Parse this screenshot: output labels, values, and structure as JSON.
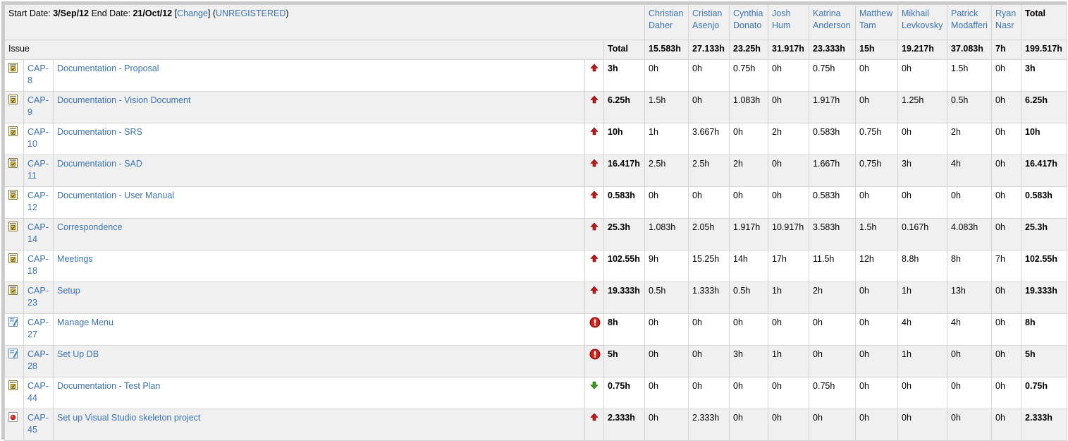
{
  "header": {
    "start_label": "Start Date:",
    "start_date": "3/Sep/12",
    "end_label": "End Date:",
    "end_date": "21/Oct/12",
    "change_link": "Change",
    "unregistered_link": "UNREGISTERED",
    "issue_col": "Issue",
    "total_col": "Total",
    "grand_total_label": "Total",
    "grand_total": "199.517h"
  },
  "people": [
    {
      "first": "Christian",
      "last": "Daher",
      "total": "15.583h"
    },
    {
      "first": "Cristian",
      "last": "Asenjo",
      "total": "27.133h"
    },
    {
      "first": "Cynthia",
      "last": "Donato",
      "total": "23.25h"
    },
    {
      "first": "Josh",
      "last": "Hum",
      "total": "31.917h"
    },
    {
      "first": "Katrina",
      "last": "Anderson",
      "total": "23.333h"
    },
    {
      "first": "Matthew",
      "last": "Tam",
      "total": "15h"
    },
    {
      "first": "Mikhail",
      "last": "Levkovsky",
      "total": "19.217h"
    },
    {
      "first": "Patrick",
      "last": "Modafferi",
      "total": "37.083h"
    },
    {
      "first": "Ryan",
      "last": "Nasr",
      "total": "7h"
    }
  ],
  "issues": [
    {
      "key_a": "CAP-",
      "key_b": "8",
      "summary": "Documentation - Proposal",
      "type": "task-icon",
      "priority": "major-priority-icon",
      "total": "3h",
      "hours": [
        "0h",
        "0h",
        "0.75h",
        "0h",
        "0.75h",
        "0h",
        "0h",
        "1.5h",
        "0h"
      ]
    },
    {
      "key_a": "CAP-",
      "key_b": "9",
      "summary": "Documentation - Vision Document",
      "type": "task-icon",
      "priority": "major-priority-icon",
      "total": "6.25h",
      "hours": [
        "1.5h",
        "0h",
        "1.083h",
        "0h",
        "1.917h",
        "0h",
        "1.25h",
        "0.5h",
        "0h"
      ]
    },
    {
      "key_a": "CAP-",
      "key_b": "10",
      "summary": "Documentation - SRS",
      "type": "task-icon",
      "priority": "major-priority-icon",
      "total": "10h",
      "hours": [
        "1h",
        "3.667h",
        "0h",
        "2h",
        "0.583h",
        "0.75h",
        "0h",
        "2h",
        "0h"
      ]
    },
    {
      "key_a": "CAP-",
      "key_b": "11",
      "summary": "Documentation - SAD",
      "type": "task-icon",
      "priority": "major-priority-icon",
      "total": "16.417h",
      "hours": [
        "2.5h",
        "2.5h",
        "2h",
        "0h",
        "1.667h",
        "0.75h",
        "3h",
        "4h",
        "0h"
      ]
    },
    {
      "key_a": "CAP-",
      "key_b": "12",
      "summary": "Documentation - User Manual",
      "type": "task-icon",
      "priority": "major-priority-icon",
      "total": "0.583h",
      "hours": [
        "0h",
        "0h",
        "0h",
        "0h",
        "0.583h",
        "0h",
        "0h",
        "0h",
        "0h"
      ]
    },
    {
      "key_a": "CAP-",
      "key_b": "14",
      "summary": "Correspondence",
      "type": "task-icon",
      "priority": "major-priority-icon",
      "total": "25.3h",
      "hours": [
        "1.083h",
        "2.05h",
        "1.917h",
        "10.917h",
        "3.583h",
        "1.5h",
        "0.167h",
        "4.083h",
        "0h"
      ]
    },
    {
      "key_a": "CAP-",
      "key_b": "18",
      "summary": "Meetings",
      "type": "task-icon",
      "priority": "major-priority-icon",
      "total": "102.55h",
      "hours": [
        "9h",
        "15.25h",
        "14h",
        "17h",
        "11.5h",
        "12h",
        "8.8h",
        "8h",
        "7h"
      ]
    },
    {
      "key_a": "CAP-",
      "key_b": "23",
      "summary": "Setup",
      "type": "task-icon",
      "priority": "major-priority-icon",
      "total": "19.333h",
      "hours": [
        "0.5h",
        "1.333h",
        "0.5h",
        "1h",
        "2h",
        "0h",
        "1h",
        "13h",
        "0h"
      ]
    },
    {
      "key_a": "CAP-",
      "key_b": "27",
      "summary": "Manage Menu",
      "type": "feature-icon",
      "priority": "blocker-priority-icon",
      "total": "8h",
      "hours": [
        "0h",
        "0h",
        "0h",
        "0h",
        "0h",
        "0h",
        "4h",
        "4h",
        "0h"
      ]
    },
    {
      "key_a": "CAP-",
      "key_b": "28",
      "summary": "Set Up DB",
      "type": "feature-icon",
      "priority": "blocker-priority-icon",
      "total": "5h",
      "hours": [
        "0h",
        "0h",
        "3h",
        "1h",
        "0h",
        "0h",
        "1h",
        "0h",
        "0h"
      ]
    },
    {
      "key_a": "CAP-",
      "key_b": "44",
      "summary": "Documentation - Test Plan",
      "type": "task-icon",
      "priority": "minor-priority-icon",
      "total": "0.75h",
      "hours": [
        "0h",
        "0h",
        "0h",
        "0h",
        "0.75h",
        "0h",
        "0h",
        "0h",
        "0h"
      ]
    },
    {
      "key_a": "CAP-",
      "key_b": "45",
      "summary": "Set up Visual Studio skeleton project",
      "type": "bug-icon",
      "priority": "major-priority-icon",
      "total": "2.333h",
      "hours": [
        "0h",
        "2.333h",
        "0h",
        "0h",
        "0h",
        "0h",
        "0h",
        "0h",
        "0h"
      ]
    }
  ]
}
